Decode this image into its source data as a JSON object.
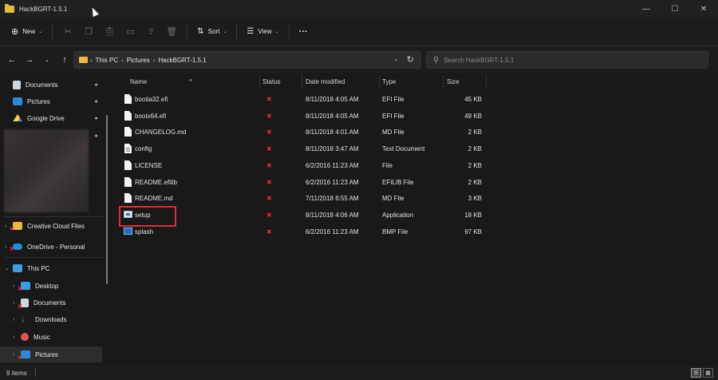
{
  "window": {
    "title": "HackBGRT-1.5.1"
  },
  "toolbar": {
    "new_label": "New",
    "sort_label": "Sort",
    "view_label": "View",
    "more_label": "···"
  },
  "address": {
    "crumbs": [
      "This PC",
      "Pictures",
      "HackBGRT-1.5.1"
    ]
  },
  "search": {
    "placeholder": "Search HackBGRT-1.5.1"
  },
  "sidebar": {
    "items": [
      {
        "label": "Documents"
      },
      {
        "label": "Pictures"
      },
      {
        "label": "Google Drive"
      },
      {
        "label": "Creative Cloud Files"
      },
      {
        "label": "OneDrive - Personal"
      },
      {
        "label": "This PC"
      },
      {
        "label": "Desktop"
      },
      {
        "label": "Documents"
      },
      {
        "label": "Downloads"
      },
      {
        "label": "Music"
      },
      {
        "label": "Pictures"
      }
    ]
  },
  "columns": {
    "name": "Name",
    "status": "Status",
    "date": "Date modified",
    "type": "Type",
    "size": "Size"
  },
  "files": [
    {
      "name": "bootia32.efi",
      "date": "8/11/2018 4:05 AM",
      "type": "EFI File",
      "size": "45 KB",
      "icon": "file-icon"
    },
    {
      "name": "bootx64.efi",
      "date": "8/11/2018 4:05 AM",
      "type": "EFI File",
      "size": "49 KB",
      "icon": "file-icon"
    },
    {
      "name": "CHANGELOG.md",
      "date": "8/11/2018 4:01 AM",
      "type": "MD File",
      "size": "2 KB",
      "icon": "file-icon"
    },
    {
      "name": "config",
      "date": "8/11/2018 3:47 AM",
      "type": "Text Document",
      "size": "2 KB",
      "icon": "text-file-icon"
    },
    {
      "name": "LICENSE",
      "date": "6/2/2016 11:23 AM",
      "type": "File",
      "size": "2 KB",
      "icon": "file-icon"
    },
    {
      "name": "README.efilib",
      "date": "6/2/2016 11:23 AM",
      "type": "EFILIB File",
      "size": "2 KB",
      "icon": "file-icon"
    },
    {
      "name": "README.md",
      "date": "7/11/2018 6:55 AM",
      "type": "MD File",
      "size": "3 KB",
      "icon": "file-icon"
    },
    {
      "name": "setup",
      "date": "8/11/2018 4:06 AM",
      "type": "Application",
      "size": "18 KB",
      "icon": "application-icon"
    },
    {
      "name": "splash",
      "date": "6/2/2016 11:23 AM",
      "type": "BMP File",
      "size": "97 KB",
      "icon": "image-file-icon"
    }
  ],
  "status_symbol": "✖",
  "statusbar": {
    "count": "9 items"
  }
}
